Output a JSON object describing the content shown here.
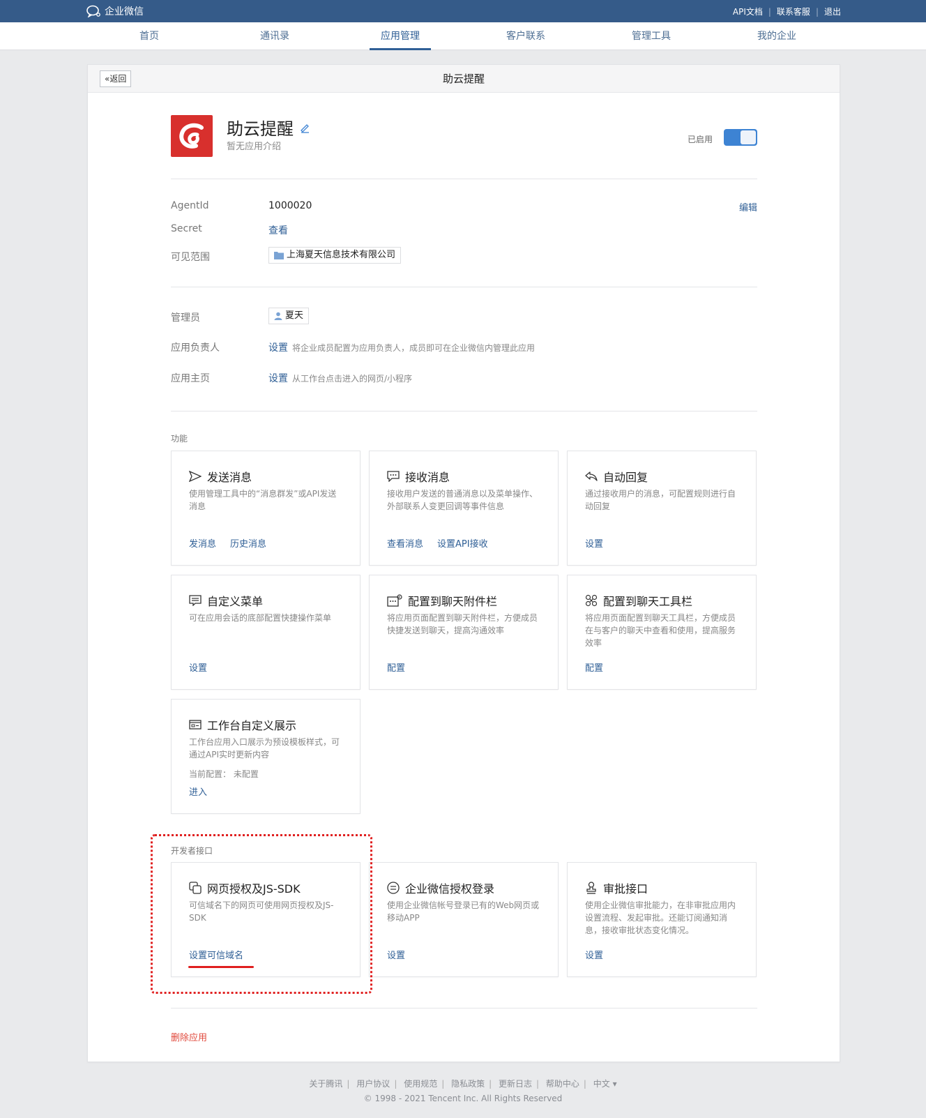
{
  "topbar": {
    "brand": "企业微信",
    "links": [
      "API文档",
      "联系客服",
      "退出"
    ]
  },
  "nav": {
    "items": [
      "首页",
      "通讯录",
      "应用管理",
      "客户联系",
      "管理工具",
      "我的企业"
    ],
    "active": "应用管理"
  },
  "header": {
    "back_label": "返回",
    "title": "助云提醒"
  },
  "app": {
    "name": "助云提醒",
    "description": "暂无应用介绍",
    "status_label": "已启用",
    "enabled": true,
    "icon_color": "#d8302d"
  },
  "info": {
    "agentid_label": "AgentId",
    "agentid_value": "1000020",
    "edit_label": "编辑",
    "secret_label": "Secret",
    "secret_action": "查看",
    "scope_label": "可见范围",
    "scope_value": "上海夏天信息技术有限公司"
  },
  "admin": {
    "admin_label": "管理员",
    "admin_value": "夏天",
    "owner_label": "应用负责人",
    "owner_action": "设置",
    "owner_hint": "将企业成员配置为应用负责人，成员即可在企业微信内管理此应用",
    "home_label": "应用主页",
    "home_action": "设置",
    "home_hint": "从工作台点击进入的网页/小程序"
  },
  "features": {
    "title": "功能",
    "cards": [
      {
        "title": "发送消息",
        "icon": "send-icon",
        "desc": "使用管理工具中的“消息群发”或API发送消息",
        "actions": [
          "发消息",
          "历史消息"
        ]
      },
      {
        "title": "接收消息",
        "icon": "chat-icon",
        "desc": "接收用户发送的普通消息以及菜单操作、外部联系人变更回调等事件信息",
        "actions": [
          "查看消息",
          "设置API接收"
        ]
      },
      {
        "title": "自动回复",
        "icon": "reply-icon",
        "desc": "通过接收用户的消息，可配置规则进行自动回复",
        "actions": [
          "设置"
        ]
      },
      {
        "title": "自定义菜单",
        "icon": "menu-icon",
        "desc": "可在应用会话的底部配置快捷操作菜单",
        "actions": [
          "设置"
        ]
      },
      {
        "title": "配置到聊天附件栏",
        "icon": "attachment-bar-icon",
        "desc": "将应用页面配置到聊天附件栏，方便成员快捷发送到聊天，提高沟通效率",
        "actions": [
          "配置"
        ]
      },
      {
        "title": "配置到聊天工具栏",
        "icon": "toolbar-icon",
        "desc": "将应用页面配置到聊天工具栏，方便成员在与客户的聊天中查看和使用，提高服务效率",
        "actions": [
          "配置"
        ]
      },
      {
        "title": "工作台自定义展示",
        "icon": "workbench-icon",
        "desc": "工作台应用入口展示为预设模板样式，可通过API实时更新内容",
        "extra": "当前配置：  未配置",
        "actions": [
          "进入"
        ]
      }
    ]
  },
  "developer": {
    "title": "开发者接口",
    "cards": [
      {
        "title": "网页授权及JS-SDK",
        "icon": "copy-pages-icon",
        "desc": "可信域名下的网页可使用网页授权及JS-SDK",
        "actions": [
          "设置可信域名"
        ]
      },
      {
        "title": "企业微信授权登录",
        "icon": "login-icon",
        "desc": "使用企业微信帐号登录已有的Web网页或移动APP",
        "actions": [
          "设置"
        ]
      },
      {
        "title": "审批接口",
        "icon": "stamp-icon",
        "desc": "使用企业微信审批能力，在非审批应用内设置流程、发起审批。还能订阅通知消息，接收审批状态变化情况。",
        "actions": [
          "设置"
        ]
      }
    ]
  },
  "delete_label": "删除应用",
  "footer": {
    "links": [
      "关于腾讯",
      "用户协议",
      "使用规范",
      "隐私政策",
      "更新日志",
      "帮助中心",
      "中文 ▾"
    ],
    "copyright": "© 1998 - 2021 Tencent Inc. All Rights Reserved"
  },
  "colors": {
    "topbar": "#355b89",
    "link": "#2f5f96",
    "danger": "#e0483b",
    "annotation": "#e02020"
  }
}
